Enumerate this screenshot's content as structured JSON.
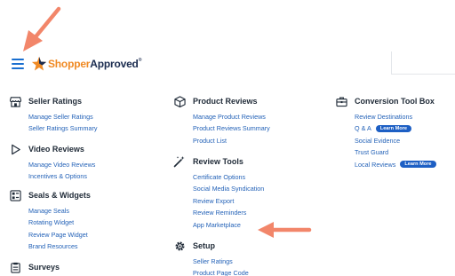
{
  "brand": {
    "logo_text_1": "Shopper",
    "logo_text_2": "Approved",
    "trademark": "®"
  },
  "colors": {
    "accent_blue": "#2563b8",
    "badge_blue": "#1d5fc4",
    "arrow_orange": "#f2866a",
    "brand_orange": "#f08a24",
    "brand_navy": "#1b2c4f"
  },
  "columns": [
    {
      "sections": [
        {
          "title": "Seller Ratings",
          "icon": "store-icon",
          "links": [
            {
              "label": "Manage Seller Ratings"
            },
            {
              "label": "Seller Ratings Summary"
            }
          ]
        },
        {
          "title": "Video Reviews",
          "icon": "play-icon",
          "links": [
            {
              "label": "Manage Video Reviews"
            },
            {
              "label": "Incentives & Options"
            }
          ]
        },
        {
          "title": "Seals & Widgets",
          "icon": "widgets-icon",
          "links": [
            {
              "label": "Manage Seals"
            },
            {
              "label": "Rotating Widget"
            },
            {
              "label": "Review Page Widget"
            },
            {
              "label": "Brand Resources"
            }
          ]
        },
        {
          "title": "Surveys",
          "icon": "clipboard-icon",
          "links": []
        }
      ]
    },
    {
      "sections": [
        {
          "title": "Product Reviews",
          "icon": "box-icon",
          "links": [
            {
              "label": "Manage Product Reviews"
            },
            {
              "label": "Product Reviews Summary"
            },
            {
              "label": "Product List"
            }
          ]
        },
        {
          "title": "Review Tools",
          "icon": "magic-wand-icon",
          "links": [
            {
              "label": "Certificate Options"
            },
            {
              "label": "Social Media Syndication"
            },
            {
              "label": "Review Export"
            },
            {
              "label": "Review Reminders"
            },
            {
              "label": "App Marketplace"
            }
          ]
        },
        {
          "title": "Setup",
          "icon": "gear-icon",
          "links": [
            {
              "label": "Seller Ratings"
            },
            {
              "label": "Product Page Code"
            }
          ]
        }
      ]
    },
    {
      "sections": [
        {
          "title": "Conversion Tool Box",
          "icon": "toolbox-icon",
          "links": [
            {
              "label": "Review Destinations"
            },
            {
              "label": "Q & A",
              "badge": "Learn More"
            },
            {
              "label": "Social Evidence"
            },
            {
              "label": "Trust Guard"
            },
            {
              "label": "Local Reviews",
              "badge": "Learn More"
            }
          ]
        }
      ]
    }
  ],
  "annotations": [
    {
      "name": "annotation-arrow-menu",
      "icon": "arrow-icon",
      "points_to": "menu-button"
    },
    {
      "name": "annotation-arrow-app-marketplace",
      "icon": "arrow-icon",
      "points_to": "App Marketplace"
    }
  ]
}
